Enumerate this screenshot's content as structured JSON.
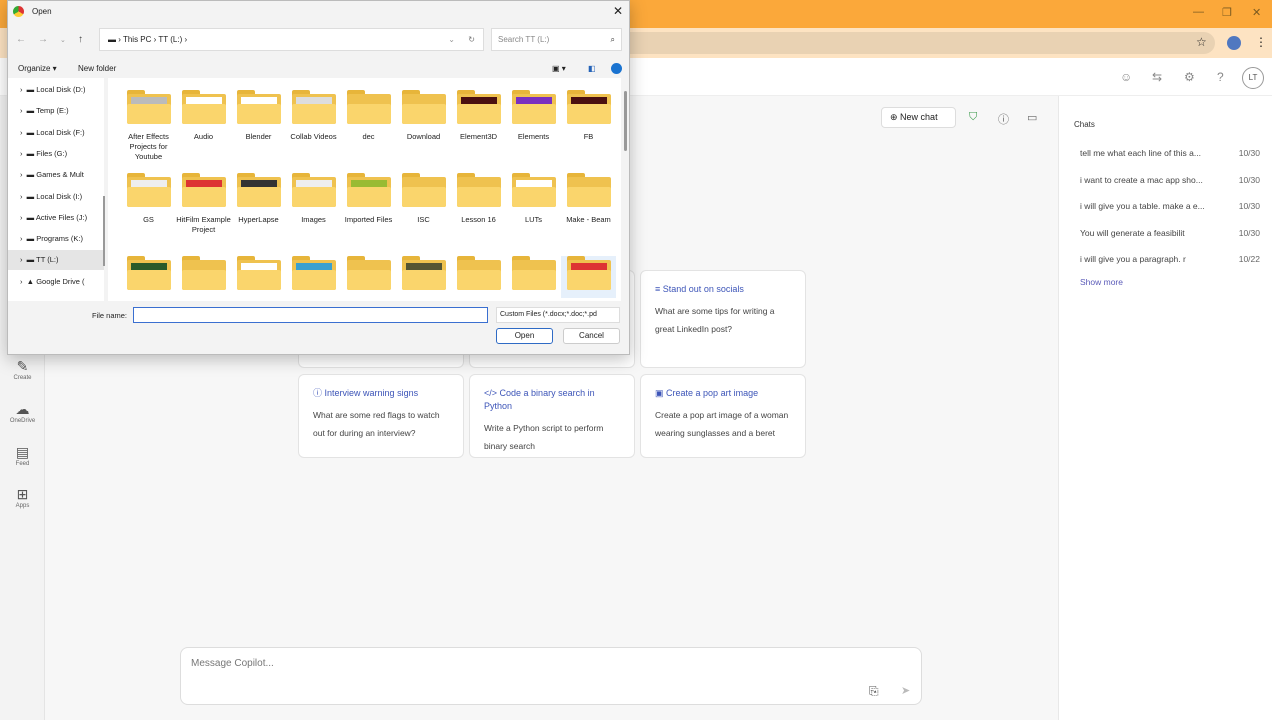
{
  "browser": {
    "minimize": "—",
    "restore": "❐",
    "close": "✕",
    "star": "☆",
    "menu": "⋮"
  },
  "header": {
    "avatar": "LT",
    "icons": [
      "emoji-icon",
      "share-icon",
      "settings-icon",
      "help-icon"
    ]
  },
  "rail": [
    {
      "label": "Create",
      "glyph": "✎"
    },
    {
      "label": "OneDrive",
      "glyph": "☁"
    },
    {
      "label": "Feed",
      "glyph": "▤"
    },
    {
      "label": "Apps",
      "glyph": "⊞"
    }
  ],
  "toolbar": {
    "new_chat": "New chat"
  },
  "chats": {
    "heading": "Chats",
    "items": [
      {
        "title": "tell me what each line of this a...",
        "date": "10/30"
      },
      {
        "title": "i want to create a mac app sho...",
        "date": "10/30"
      },
      {
        "title": "i will give you a table. make a e...",
        "date": "10/30"
      },
      {
        "title": "You will generate a feasibilit",
        "date": "10/30"
      },
      {
        "title": "i will give you a paragraph. r",
        "date": "10/22"
      }
    ],
    "show_more": "Show more"
  },
  "cards": [
    {
      "title": "Stand out on socials",
      "body": "What are some tips for writing a great LinkedIn post?",
      "icon": "≡"
    },
    {
      "title": "Interview warning signs",
      "body": "What are some red flags to watch out for during an interview?",
      "icon": "ⓘ"
    },
    {
      "title": "Code a binary search in Python",
      "body": "Write a Python script to perform binary search",
      "icon": "</>"
    },
    {
      "title": "Create a pop art image",
      "body": "Create a pop art image of a woman wearing sunglasses and a beret",
      "icon": "▣"
    }
  ],
  "composer": {
    "placeholder": "Message Copilot..."
  },
  "dialog": {
    "title": "Open",
    "breadcrumb": [
      "This PC",
      "TT (L:)"
    ],
    "search_placeholder": "Search TT (L:)",
    "organize": "Organize ▾",
    "new_folder": "New folder",
    "tree": [
      "Local Disk (D:)",
      "Temp (E:)",
      "Local Disk (F:)",
      "Files (G:)",
      "Games & Mult",
      "Local Disk (I:)",
      "Active Files (J:)",
      "Programs (K:)",
      "TT (L:)",
      "Google Drive ("
    ],
    "folders": [
      "After Effects Projects for Youtube",
      "Audio",
      "Blender",
      "Collab Videos",
      "dec",
      "Download",
      "Element3D",
      "Elements",
      "FB",
      "GS",
      "HitFilm Example Project",
      "HyperLapse",
      "Images",
      "Imported Files",
      "ISC",
      "Lesson 16",
      "LUTs",
      "Make - Beam",
      "",
      "",
      "",
      "",
      "",
      "",
      "",
      "",
      ""
    ],
    "file_name_label": "File name:",
    "file_name_value": "",
    "file_type": "Custom Files (*.docx;*.doc;*.pd",
    "open": "Open",
    "cancel": "Cancel"
  }
}
